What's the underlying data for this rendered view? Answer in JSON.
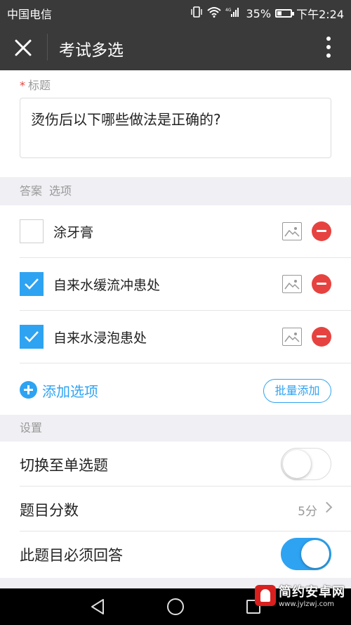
{
  "status_bar": {
    "carrier": "中国电信",
    "battery_percent": "35%",
    "battery_level": 0.35,
    "time": "下午2:24",
    "network": "4G",
    "icons": [
      "vibrate-icon",
      "wifi-icon",
      "signal-icon",
      "battery-icon"
    ]
  },
  "header": {
    "title": "考试多选",
    "close_icon": "close-icon",
    "more_icon": "more-vertical-icon"
  },
  "question": {
    "required_mark": "*",
    "label": "标题",
    "text": "烫伤后以下哪些做法是正确的?"
  },
  "options_header": {
    "answer_label": "答案",
    "options_label": "选项"
  },
  "options": [
    {
      "label": "涂牙膏",
      "checked": false
    },
    {
      "label": "自来水缓流冲患处",
      "checked": true
    },
    {
      "label": "自来水浸泡患处",
      "checked": true
    }
  ],
  "add_option": {
    "label": "添加选项",
    "batch_label": "批量添加"
  },
  "settings": {
    "header": "设置",
    "switch_single": {
      "label": "切换至单选题",
      "on": false
    },
    "score": {
      "label": "题目分数",
      "value": "5分"
    },
    "required": {
      "label": "此题目必须回答",
      "on": true
    }
  },
  "watermark": {
    "name": "简约安卓网",
    "url": "www.jylzwj.com"
  },
  "colors": {
    "accent": "#2ea3f2",
    "danger": "#e64340",
    "header_bg": "#3a3a3a",
    "section_bg": "#efeff4"
  }
}
